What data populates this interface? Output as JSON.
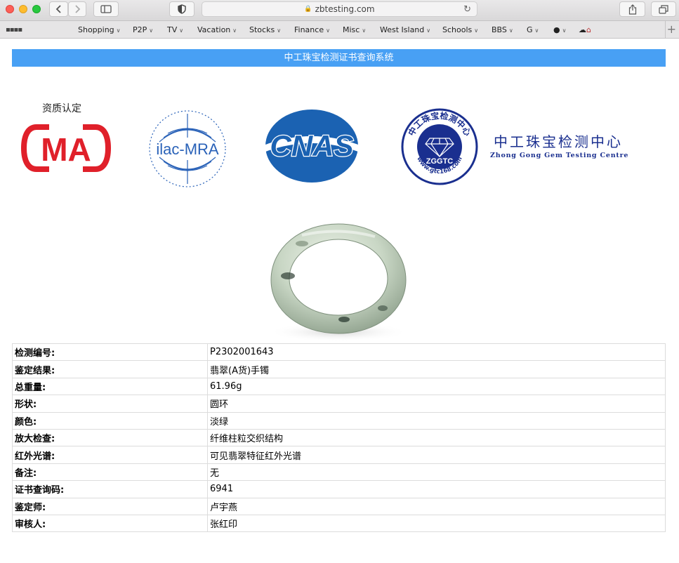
{
  "browser": {
    "address": "zbtesting.com",
    "bookmarks": [
      {
        "label": "Shopping"
      },
      {
        "label": "P2P"
      },
      {
        "label": "TV"
      },
      {
        "label": "Vacation"
      },
      {
        "label": "Stocks"
      },
      {
        "label": "Finance"
      },
      {
        "label": "Misc"
      },
      {
        "label": "West Island"
      },
      {
        "label": "Schools"
      },
      {
        "label": "BBS"
      },
      {
        "label": "G"
      },
      {
        "label": ""
      }
    ]
  },
  "page": {
    "banner_title": "中工珠宝检测证书查询系统",
    "logos": {
      "cma_caption": "资质认定",
      "cma_text": "MA",
      "ilac_text": "ilac-MRA",
      "cnas_text": "CNAS",
      "zggtc_ring_text": "中工珠宝检测中心",
      "zggtc_center": "ZGGTC",
      "zggtc_url": "www.gtc168.com",
      "center_name_cn": "中工珠宝检测中心",
      "center_name_en": "Zhong Gong Gem Testing Centre"
    },
    "colors": {
      "banner": "#48a0f4",
      "cma_red": "#e0202a",
      "cnas_blue": "#1b62b2",
      "zggtc_blue": "#1a2f8f"
    },
    "rows": [
      {
        "label": "检测编号:",
        "value": "P2302001643"
      },
      {
        "label": "鉴定结果:",
        "value": "翡翠(A货)手镯"
      },
      {
        "label": "总重量:",
        "value": "61.96g"
      },
      {
        "label": "形状:",
        "value": "圆环"
      },
      {
        "label": "颜色:",
        "value": "淡绿"
      },
      {
        "label": "放大检查:",
        "value": "纤维柱粒交织结构"
      },
      {
        "label": "红外光谱:",
        "value": "可见翡翠特征红外光谱"
      },
      {
        "label": "备注:",
        "value": "无"
      },
      {
        "label": "证书查询码:",
        "value": "6941"
      },
      {
        "label": "鉴定师:",
        "value": "卢宇燕"
      },
      {
        "label": "审核人:",
        "value": "张红印"
      }
    ]
  }
}
